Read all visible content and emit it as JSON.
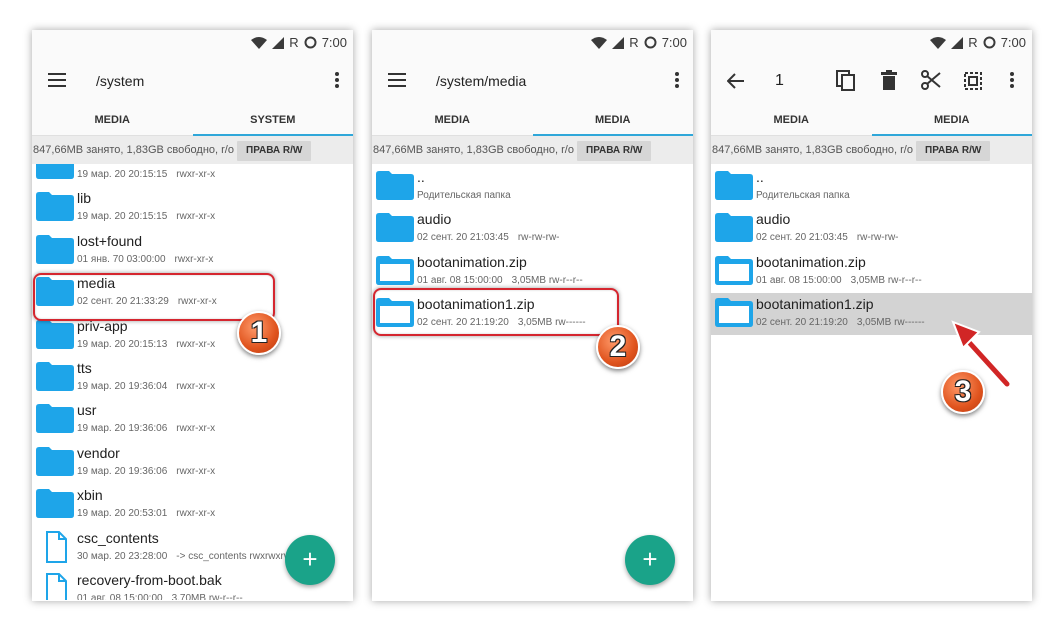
{
  "status": {
    "carrier": "R",
    "time": "7:00"
  },
  "colors": {
    "accent": "#2fa7d9",
    "folder": "#1ea5e9",
    "fab": "#1aa389",
    "highlight": "#d5262f",
    "badge": "#e0541e"
  },
  "storage": {
    "info": "847,66MB занято, 1,83GB свободно, r/o",
    "rw_button": "ПРАВА R/W"
  },
  "screens": [
    {
      "title": "/system",
      "tabs": [
        "MEDIA",
        "SYSTEM"
      ],
      "files": [
        {
          "name": "",
          "date": "19 мар. 20 20:15:15",
          "perm": "rwxr-xr-x",
          "icon": "folder-icon"
        },
        {
          "name": "lib",
          "date": "19 мар. 20 20:15:15",
          "perm": "rwxr-xr-x",
          "icon": "folder-icon"
        },
        {
          "name": "lost+found",
          "date": "01 янв. 70 03:00:00",
          "perm": "rwxr-xr-x",
          "icon": "folder-icon"
        },
        {
          "name": "media",
          "date": "02 сент. 20 21:33:29",
          "perm": "rwxr-xr-x",
          "icon": "folder-icon"
        },
        {
          "name": "priv-app",
          "date": "19 мар. 20 20:15:13",
          "perm": "rwxr-xr-x",
          "icon": "folder-icon"
        },
        {
          "name": "tts",
          "date": "19 мар. 20 19:36:04",
          "perm": "rwxr-xr-x",
          "icon": "folder-icon"
        },
        {
          "name": "usr",
          "date": "19 мар. 20 19:36:06",
          "perm": "rwxr-xr-x",
          "icon": "folder-icon"
        },
        {
          "name": "vendor",
          "date": "19 мар. 20 19:36:06",
          "perm": "rwxr-xr-x",
          "icon": "folder-icon"
        },
        {
          "name": "xbin",
          "date": "19 мар. 20 20:53:01",
          "perm": "rwxr-xr-x",
          "icon": "folder-icon"
        },
        {
          "name": "csc_contents",
          "date": "30 мар. 20 23:28:00",
          "perm": "-> csc_contents  rwxrwxrwx",
          "icon": "file-icon"
        },
        {
          "name": "recovery-from-boot.bak",
          "date": "01 авг. 08 15:00:00",
          "perm": "3,70MB  rw-r--r--",
          "icon": "file-icon"
        }
      ]
    },
    {
      "title": "/system/media",
      "tabs": [
        "MEDIA",
        "MEDIA"
      ],
      "files": [
        {
          "name": "..",
          "date": "Родительская папка",
          "perm": "",
          "icon": "folder-icon"
        },
        {
          "name": "audio",
          "date": "02 сент. 20 21:03:45",
          "perm": "rw-rw-rw-",
          "icon": "folder-icon"
        },
        {
          "name": "bootanimation.zip",
          "date": "01 авг. 08 15:00:00",
          "perm": "3,05MB  rw-r--r--",
          "icon": "zip-icon"
        },
        {
          "name": "bootanimation1.zip",
          "date": "02 сент. 20 21:19:20",
          "perm": "3,05MB  rw------",
          "icon": "zip-icon"
        }
      ]
    },
    {
      "selected_count": "1",
      "tabs": [
        "MEDIA",
        "MEDIA"
      ],
      "files": [
        {
          "name": "..",
          "date": "Родительская папка",
          "perm": "",
          "icon": "folder-icon"
        },
        {
          "name": "audio",
          "date": "02 сент. 20 21:03:45",
          "perm": "rw-rw-rw-",
          "icon": "folder-icon"
        },
        {
          "name": "bootanimation.zip",
          "date": "01 авг. 08 15:00:00",
          "perm": "3,05MB  rw-r--r--",
          "icon": "zip-icon"
        },
        {
          "name": "bootanimation1.zip",
          "date": "02 сент. 20 21:19:20",
          "perm": "3,05MB  rw------",
          "icon": "zip-icon"
        }
      ]
    }
  ],
  "fab_label": "+",
  "steps": [
    "1",
    "2",
    "3"
  ]
}
